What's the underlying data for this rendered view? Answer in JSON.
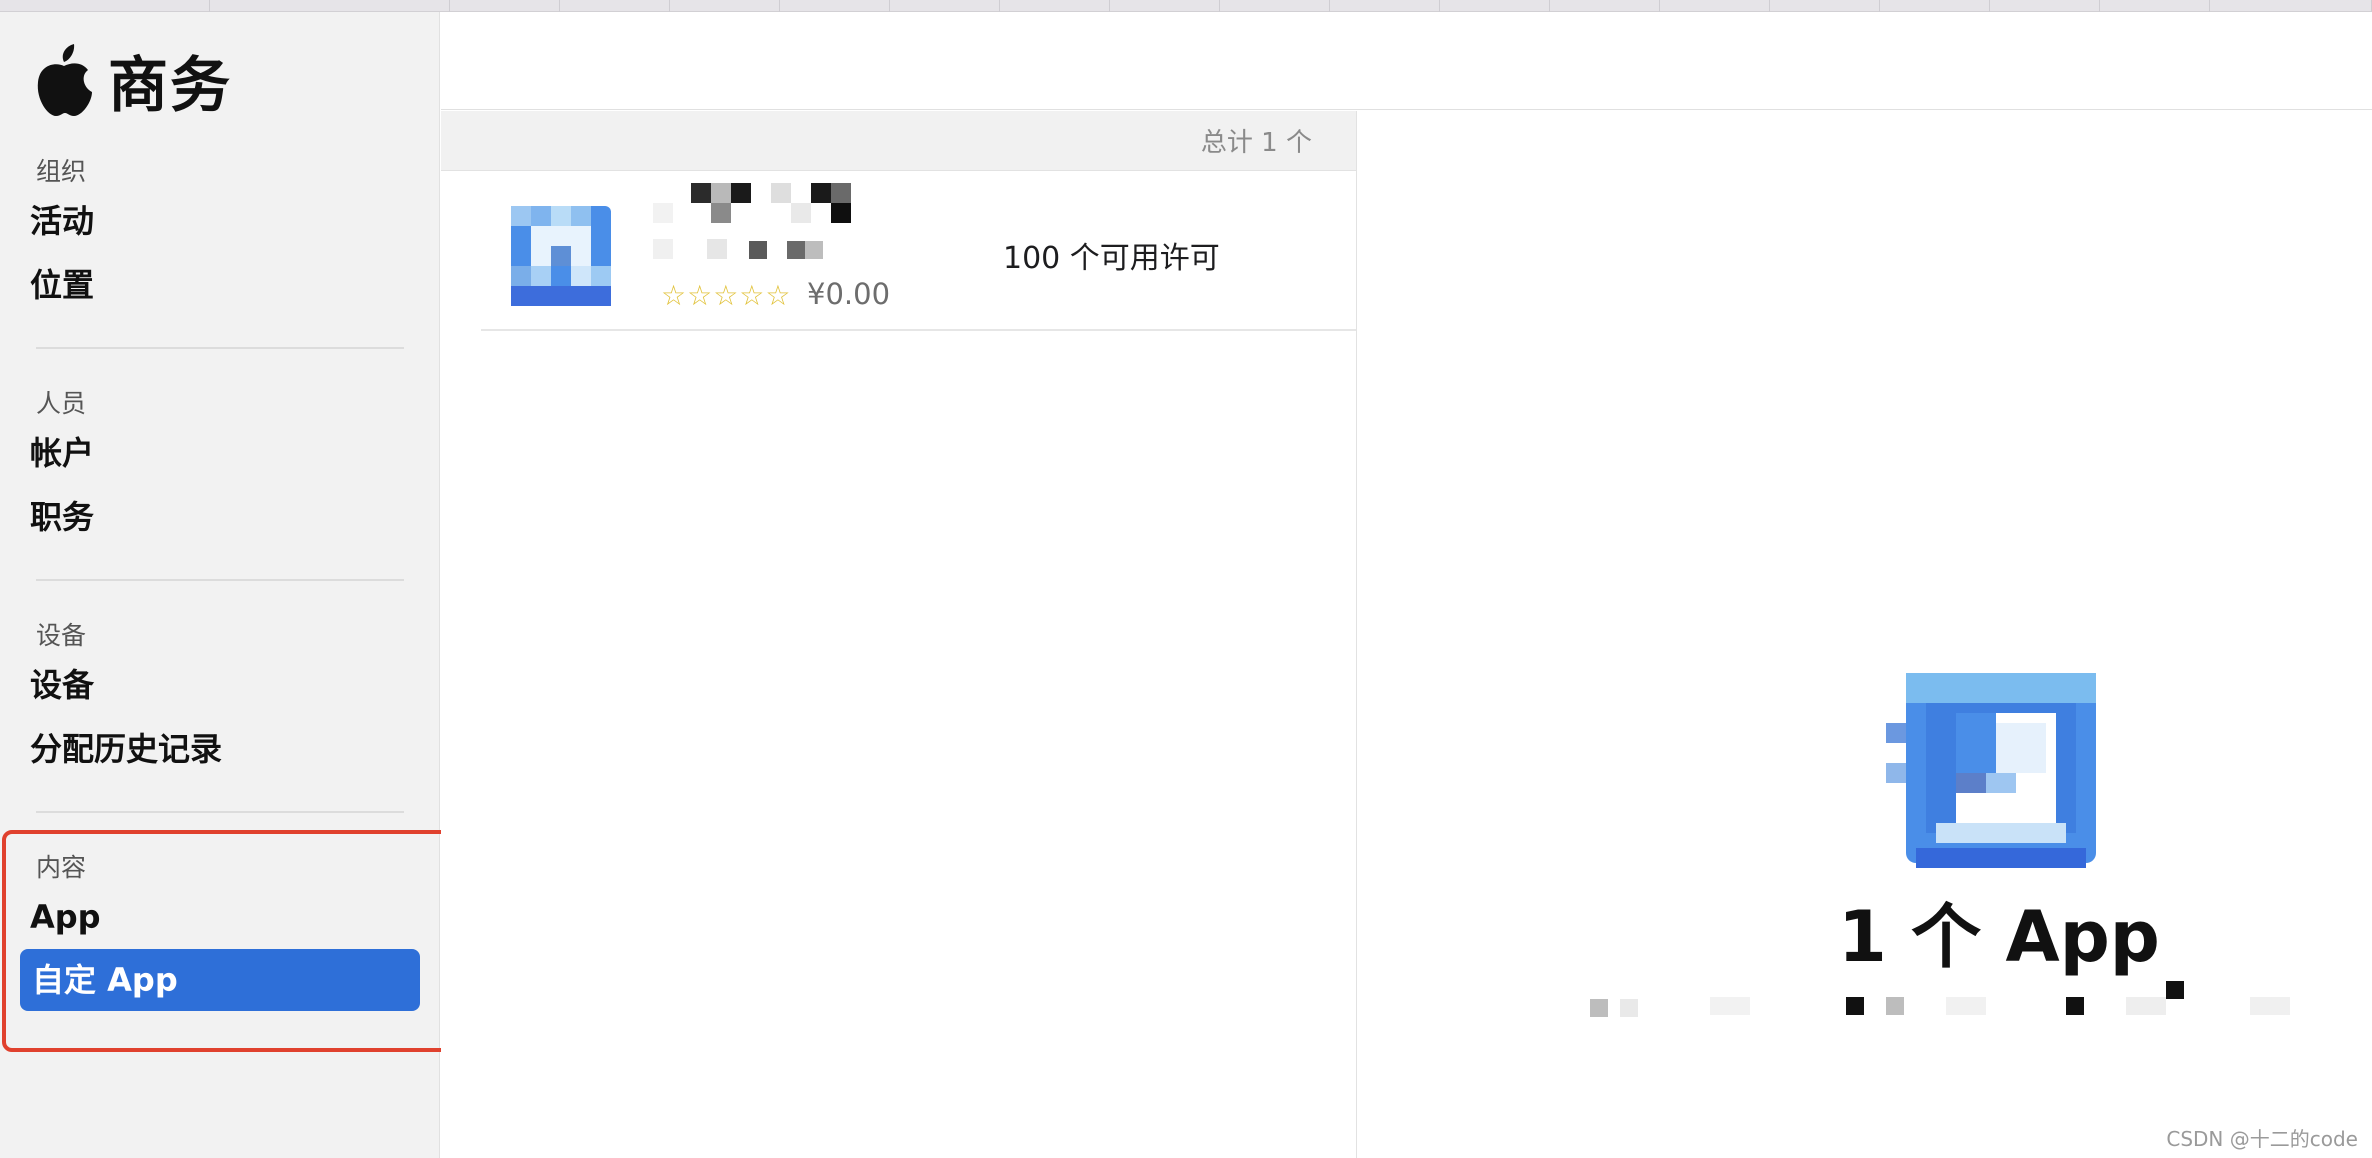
{
  "sidebar": {
    "title": "商务",
    "sections": [
      {
        "label": "组织",
        "items": [
          "活动",
          "位置"
        ]
      },
      {
        "label": "人员",
        "items": [
          "帐户",
          "职务"
        ]
      },
      {
        "label": "设备",
        "items": [
          "设备",
          "分配历史记录"
        ]
      },
      {
        "label": "内容",
        "items": [
          "App",
          "自定 App"
        ]
      }
    ],
    "active_item": "自定 App"
  },
  "list": {
    "total": "总计 1 个",
    "rows": [
      {
        "subtitle": "...",
        "license": "100 个可用许可",
        "stars": "☆☆☆☆☆",
        "price": "¥0.00"
      }
    ]
  },
  "detail": {
    "count": "1 个 App"
  },
  "watermark": "CSDN @十二的code",
  "colors": {
    "accent": "#2e6fd8",
    "highlight": "#e0412e",
    "sidebar_bg": "#f2f2f2"
  },
  "icons": {
    "brand": "apple-logo-icon",
    "app": "app-icon"
  }
}
